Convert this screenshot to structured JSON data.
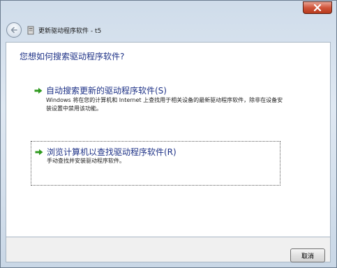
{
  "window": {
    "title": "更新驱动程序软件 - t5",
    "close_icon": "close-icon",
    "back_icon": "back-arrow-icon",
    "wizard_icon": "hardware-device-icon"
  },
  "content": {
    "heading": "您想如何搜索驱动程序软件?",
    "options": [
      {
        "title": "自动搜索更新的驱动程序软件(S)",
        "description": "Windows 将在您的计算机和 Internet 上查找用于相关设备的最新驱动程序软件，除非在设备安装设置中禁用该功能。",
        "icon": "green-arrow-icon"
      },
      {
        "title": "浏览计算机以查找驱动程序软件(R)",
        "description": "手动查找并安装驱动程序软件。",
        "icon": "green-arrow-icon"
      }
    ]
  },
  "footer": {
    "cancel_label": "取消"
  },
  "colors": {
    "link_blue": "#1e3287",
    "arrow_green": "#2f9a1f",
    "close_red": "#c8412a"
  }
}
